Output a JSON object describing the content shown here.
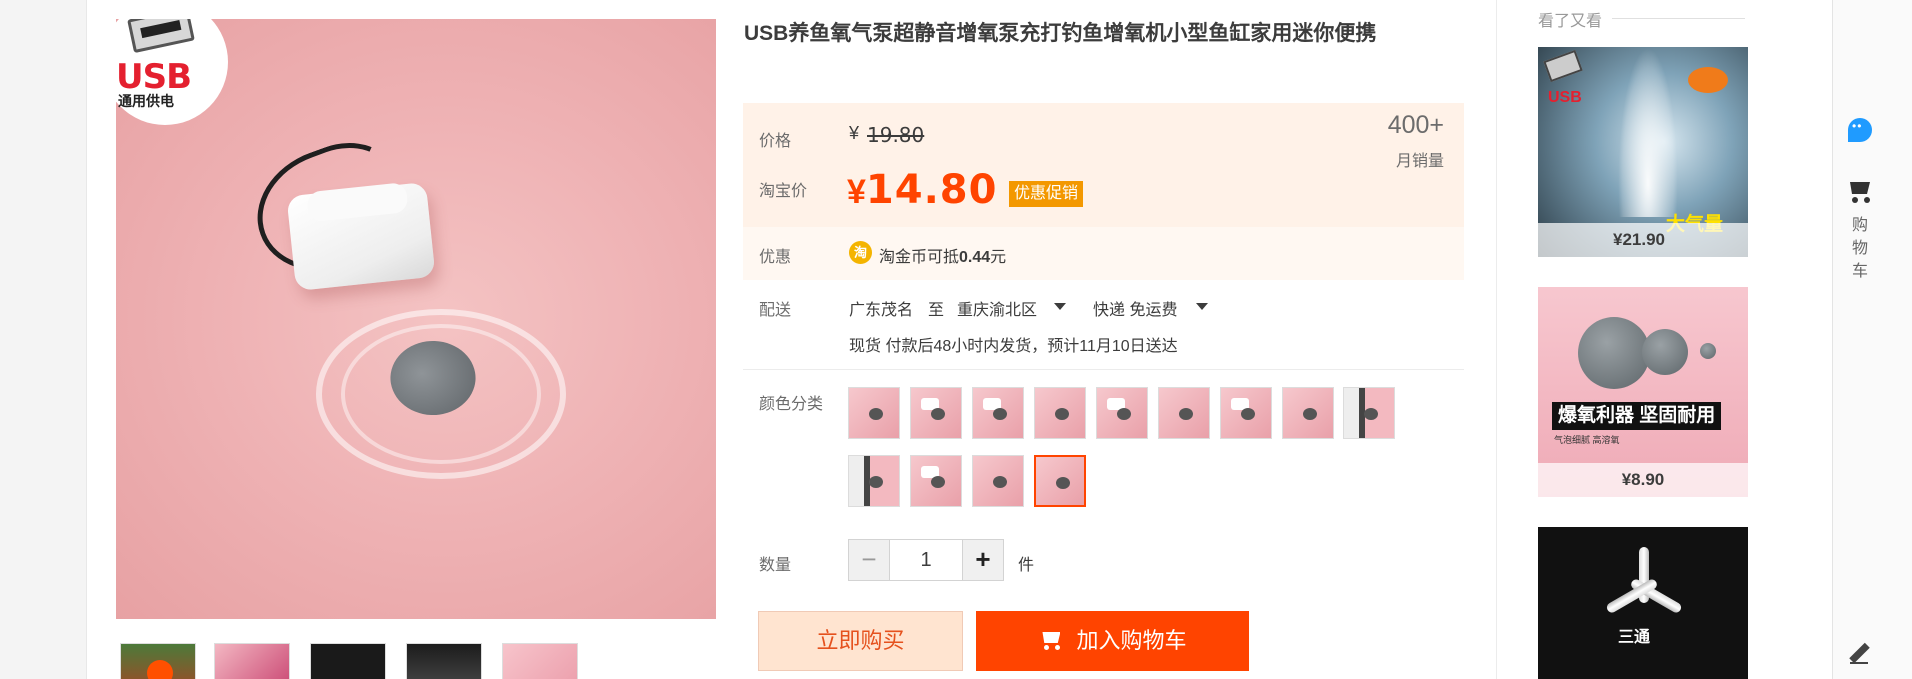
{
  "gallery": {
    "badge_text": "USB",
    "badge_subtext": "通用供电"
  },
  "product": {
    "title": "USB养鱼氧气泵超静音增氧泵充打钓鱼增氧机小型鱼缸家用迷你便携"
  },
  "price": {
    "label": "价格",
    "currency": "¥",
    "original": "19.80",
    "sales_count": "400+",
    "sales_label": "月销量",
    "taobao_label": "淘宝价",
    "current_currency": "¥",
    "current": "14.80",
    "promo_tag": "优惠促销"
  },
  "discount": {
    "label": "优惠",
    "coin_icon": "淘",
    "text": "淘金币可抵",
    "amount": "0.44",
    "unit": "元"
  },
  "shipping": {
    "label": "配送",
    "from": "广东茂名",
    "to_word": "至",
    "destination": "重庆渝北区",
    "method": "快递 免运费",
    "note": "现货 付款后48小时内发货，预计11月10日送达"
  },
  "sku": {
    "label": "颜色分类",
    "options": 13,
    "selected_index": 12
  },
  "quantity": {
    "label": "数量",
    "value": "1",
    "unit": "件",
    "minus": "−",
    "plus": "+"
  },
  "actions": {
    "buy_now": "立即购买",
    "add_to_cart": "加入购物车"
  },
  "recommendations": {
    "title": "看了又看",
    "items": [
      {
        "price": "¥21.90",
        "overlay": "大气量",
        "badge": "USB"
      },
      {
        "price": "¥8.90",
        "overlay": "爆氧利器 坚固耐用",
        "small": "气泡细腻 高溶氧"
      },
      {
        "overlay": "三通"
      }
    ]
  },
  "toolbar": {
    "cart_label": "购物车"
  },
  "colors": {
    "accent": "#ff4400",
    "price_bg": "#fff2e8",
    "promo": "#f39800",
    "buy_now_bg": "#ffe4d0"
  }
}
